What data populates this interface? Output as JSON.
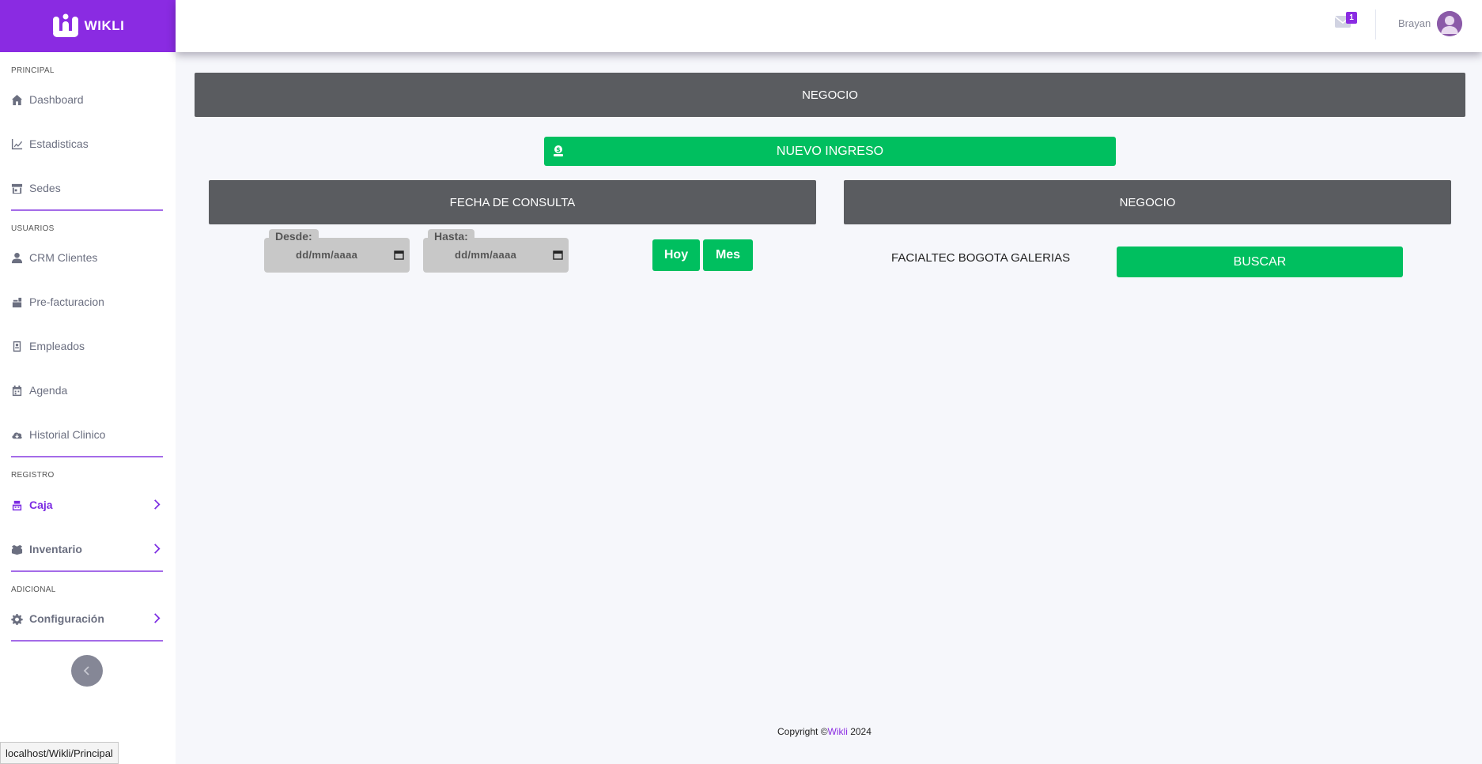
{
  "brand": {
    "name": "WIKLI",
    "color": "#8a2be2"
  },
  "sidebar": {
    "sections": {
      "principal": "PRINCIPAL",
      "usuarios": "USUARIOS",
      "registro": "REGISTRO",
      "adicional": "ADICIONAL"
    },
    "items": [
      {
        "label": "Dashboard",
        "icon": "home-icon"
      },
      {
        "label": "Estadisticas",
        "icon": "chart-line-icon"
      },
      {
        "label": "Sedes",
        "icon": "store-icon"
      },
      {
        "label": "CRM Clientes",
        "icon": "user-icon"
      },
      {
        "label": "Pre-facturacion",
        "icon": "cash-register-icon"
      },
      {
        "label": "Empleados",
        "icon": "id-badge-icon"
      },
      {
        "label": "Agenda",
        "icon": "calendar-icon"
      },
      {
        "label": "Historial Clinico",
        "icon": "cloud-download-icon"
      },
      {
        "label": "Caja",
        "icon": "cash-box-icon",
        "active": true
      },
      {
        "label": "Inventario",
        "icon": "boxes-icon"
      },
      {
        "label": "Configuración",
        "icon": "gear-icon"
      }
    ]
  },
  "topbar": {
    "notification_count": "1",
    "user_name": "Brayan"
  },
  "main": {
    "header_title": "NEGOCIO",
    "new_income_label": "NUEVO INGRESO",
    "date_panel_title": "FECHA DE CONSULTA",
    "business_panel_title": "NEGOCIO",
    "from_label": "Desde:",
    "to_label": "Hasta:",
    "date_placeholder": "dd/mm/aaaa",
    "today_label": "Hoy",
    "month_label": "Mes",
    "store_name": "FACIALTEC BOGOTA GALERIAS",
    "search_label": "BUSCAR"
  },
  "footer": {
    "copyright": "Copyright ©",
    "brand": "Wikli",
    "year": " 2024"
  },
  "status_url": "localhost/Wikli/Principal",
  "colors": {
    "accent": "#8a2be2",
    "success": "#00bf5f",
    "panel": "#5a5c60"
  }
}
